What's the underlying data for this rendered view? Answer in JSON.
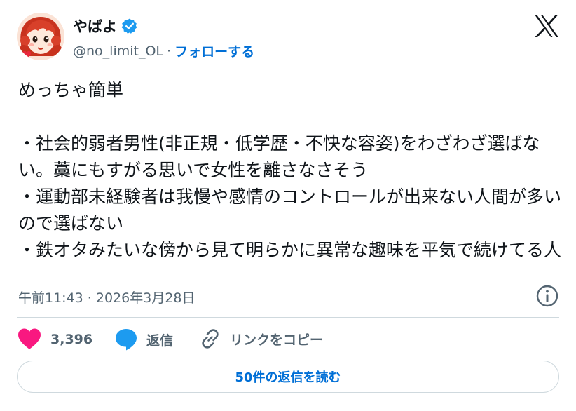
{
  "author": {
    "display_name": "やばよ",
    "handle": "@no_limit_OL",
    "separator": "·",
    "follow_label": "フォローする",
    "verified_icon": "verified-badge-icon",
    "verified_color": "#1d9bf0"
  },
  "tweet": {
    "text": "めっちゃ簡単\n\n・社会的弱者男性(非正規・低学歴・不快な容姿)をわざわざ選ばない。藁にもすがる思いで女性を離さなさそう\n・運動部未経験者は我慢や感情のコントロールが出来ない人間が多いので選ばない\n・鉄オタみたいな傍から見て明らかに異常な趣味を平気で続けてる人",
    "timestamp": "午前11:43 · 2026年3月28日"
  },
  "actions": {
    "like_count": "3,396",
    "reply_label": "返信",
    "copy_link_label": "リンクをコピー"
  },
  "read_replies_label": "50件の返信を読む",
  "colors": {
    "like": "#f91880",
    "reply": "#1d9bf0",
    "link": "#006fd6",
    "secondary_text": "#536471",
    "border": "#cfd9de"
  }
}
